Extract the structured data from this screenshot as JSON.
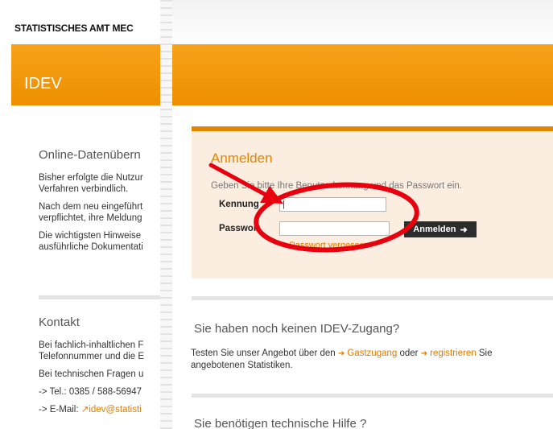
{
  "left_page": {
    "brand": "STATISTISCHES AMT MEC",
    "section_title": "IDEV",
    "content_heading": "Online-Datenübern",
    "paragraphs": [
      [
        "Bisher erfolgte die Nutzur",
        "Verfahren verbindlich."
      ],
      [
        "Nach dem neu eingeführt",
        "verpflichtet, ihre Meldung"
      ],
      [
        "Die wichtigsten Hinweise",
        "ausführliche Dokumentati"
      ]
    ],
    "contact_heading": "Kontakt",
    "contact_lines": [
      [
        "Bei fachlich-inhaltlichen F",
        "Telefonnummer und die E"
      ],
      [
        "Bei technischen Fragen u"
      ],
      [
        "-> Tel.: 0385 / 588-56947"
      ]
    ],
    "email_prefix": "-> E-Mail:",
    "email_link": "idev@statisti"
  },
  "login": {
    "title": "Anmelden",
    "hint": "Geben Sie bitte Ihre Benutzerkennung und das Passwort ein.",
    "kennung_label": "Kennung",
    "kennung_value": "|",
    "passwort_label": "Passwort",
    "passwort_value": "",
    "button_label": "Anmelden",
    "forgot_label": "Passwort vergessen?"
  },
  "access": {
    "title": "Sie haben noch keinen IDEV-Zugang?",
    "text_before": "Testen Sie unser Angebot über den",
    "guest_link": "Gastzugang",
    "text_or": "oder",
    "register_link": "registrieren",
    "text_after": "Sie",
    "line2": "angebotenen Statistiken."
  },
  "help": {
    "title": "Sie benötigen technische Hilfe ?"
  },
  "annotation_color": "#e8000f",
  "accent_color": "#ee8f00",
  "icons": [
    "arrow-right-icon",
    "annotation-arrow",
    "annotation-ellipse"
  ]
}
